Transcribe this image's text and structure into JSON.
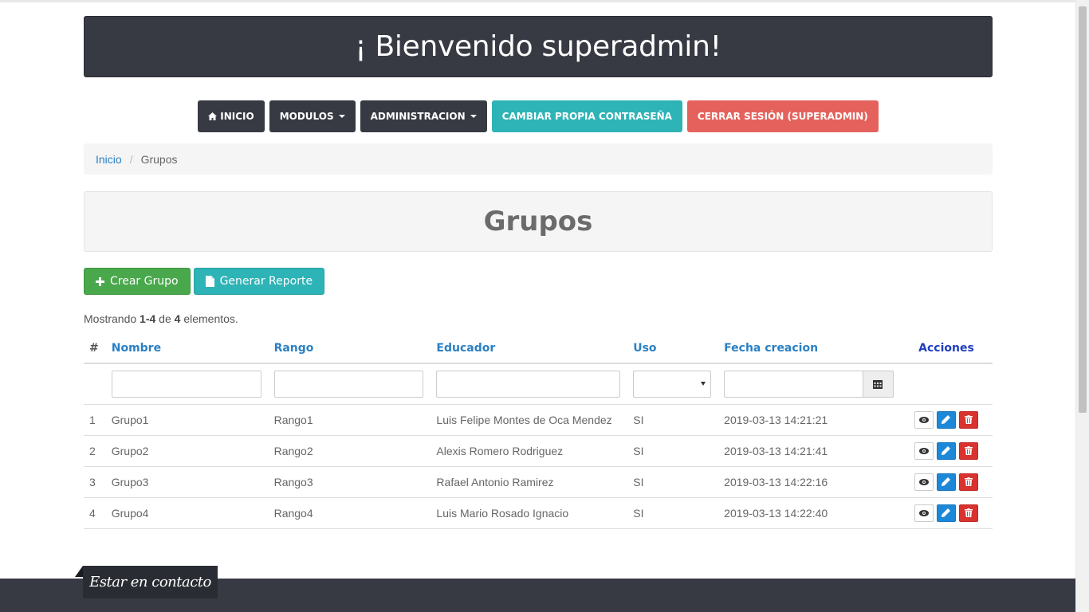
{
  "banner": {
    "title": "¡ Bienvenido superadmin!"
  },
  "nav": {
    "inicio": "INICIO",
    "modulos": "MODULOS",
    "administracion": "ADMINISTRACION",
    "cambiar": "CAMBIAR PROPIA CONTRASEÑA",
    "cerrar": "CERRAR SESIÓN (SUPERADMIN)"
  },
  "breadcrumb": {
    "home": "Inicio",
    "current": "Grupos"
  },
  "page": {
    "title": "Grupos"
  },
  "buttons": {
    "crear": "Crear Grupo",
    "reporte": "Generar Reporte"
  },
  "summary": {
    "prefix": "Mostrando",
    "range": "1-4",
    "mid": "de",
    "total": "4",
    "suffix": "elementos."
  },
  "table": {
    "headers": {
      "num": "#",
      "nombre": "Nombre",
      "rango": "Rango",
      "educador": "Educador",
      "uso": "Uso",
      "fecha": "Fecha creacion",
      "acciones": "Acciones"
    },
    "rows": [
      {
        "num": "1",
        "nombre": "Grupo1",
        "rango": "Rango1",
        "educador": "Luis Felipe Montes de Oca Mendez",
        "uso": "SI",
        "fecha": "2019-03-13 14:21:21"
      },
      {
        "num": "2",
        "nombre": "Grupo2",
        "rango": "Rango2",
        "educador": "Alexis Romero Rodriguez",
        "uso": "SI",
        "fecha": "2019-03-13 14:21:41"
      },
      {
        "num": "3",
        "nombre": "Grupo3",
        "rango": "Rango3",
        "educador": "Rafael Antonio Ramirez",
        "uso": "SI",
        "fecha": "2019-03-13 14:22:16"
      },
      {
        "num": "4",
        "nombre": "Grupo4",
        "rango": "Rango4",
        "educador": "Luis Mario Rosado Ignacio",
        "uso": "SI",
        "fecha": "2019-03-13 14:22:40"
      }
    ]
  },
  "footer": {
    "contact": "Estar en contacto"
  },
  "icons": {
    "home": "home-icon",
    "plus": "plus-icon",
    "file": "file-icon",
    "calendar": "calendar-icon",
    "view": "eye-icon",
    "edit": "pencil-icon",
    "delete": "trash-icon"
  },
  "colors": {
    "dark": "#373a43",
    "teal": "#2eb3b6",
    "red": "#e5625c",
    "green": "#49a84b",
    "link": "#2a80c4",
    "edit": "#1e88d8",
    "delete": "#d9332f"
  }
}
